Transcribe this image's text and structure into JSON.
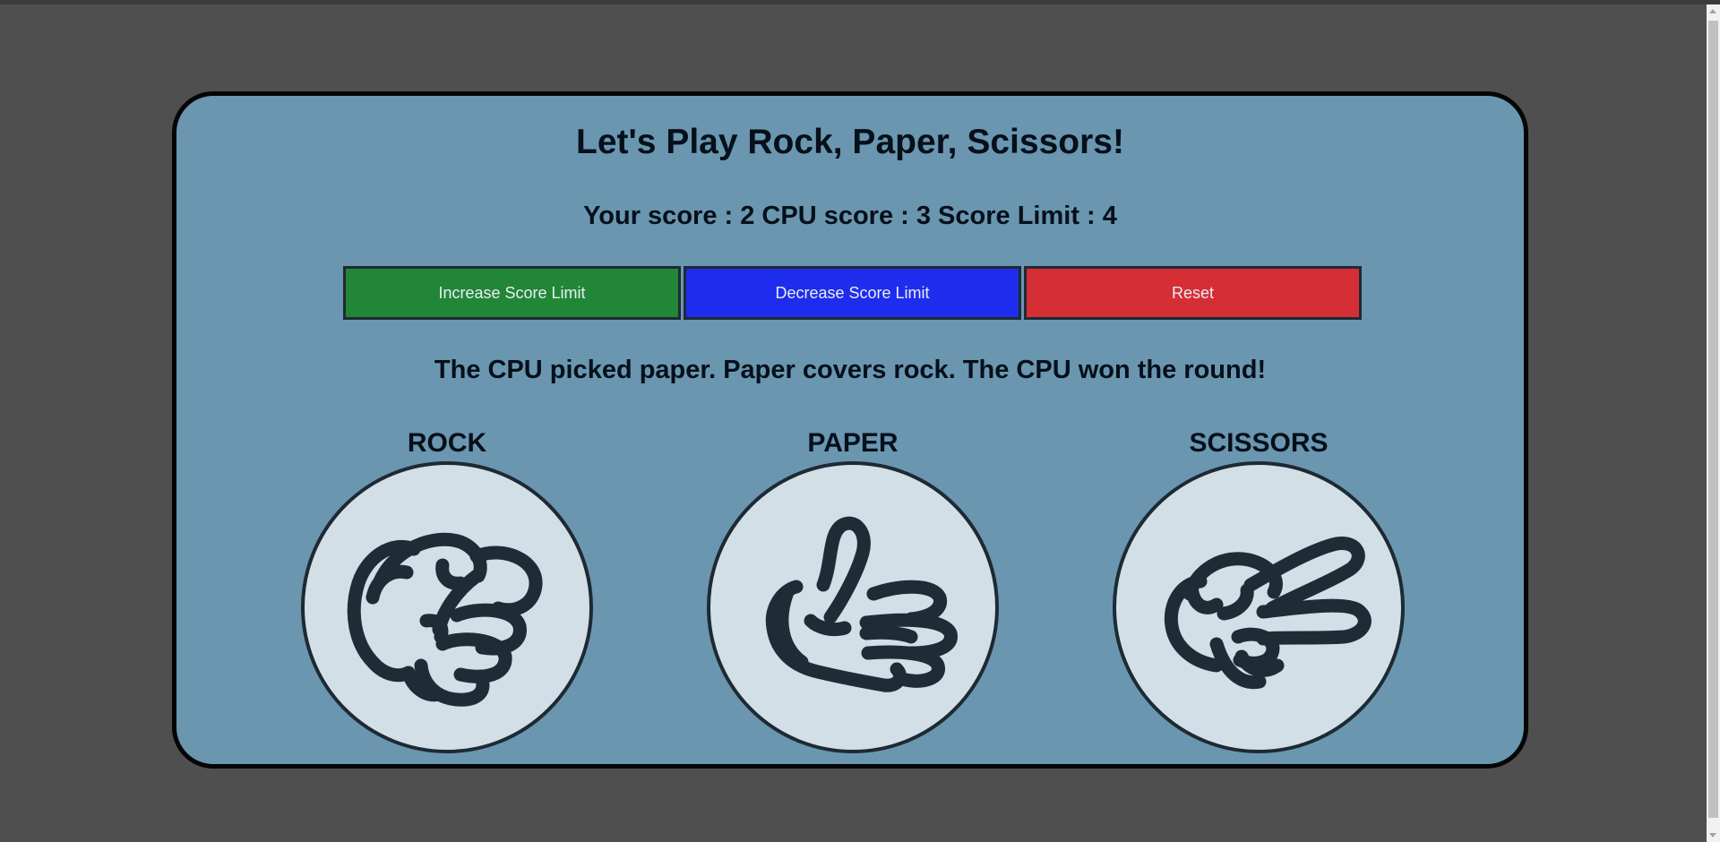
{
  "game": {
    "title": "Let's Play Rock, Paper, Scissors!",
    "score": {
      "your_label": "Your score : ",
      "your_value": "2",
      "cpu_label": " CPU score : ",
      "cpu_value": "3",
      "limit_label": " Score Limit : ",
      "limit_value": "4"
    },
    "buttons": {
      "increase": "Increase Score Limit",
      "decrease": "Decrease Score Limit",
      "reset": "Reset"
    },
    "message": "The CPU picked paper. Paper covers rock. The CPU won the round!",
    "choices": [
      {
        "label": "ROCK",
        "icon": "rock-hand-icon"
      },
      {
        "label": "PAPER",
        "icon": "paper-hand-icon"
      },
      {
        "label": "SCISSORS",
        "icon": "scissors-hand-icon"
      }
    ]
  },
  "colors": {
    "page_background": "#4f4f4f",
    "card_background": "#6a96b0",
    "increase_button": "#218636",
    "decrease_button": "#1e2ded",
    "reset_button": "#d62e35",
    "choice_circle": "#d2dfe7",
    "icon_stroke": "#1f2c35"
  }
}
